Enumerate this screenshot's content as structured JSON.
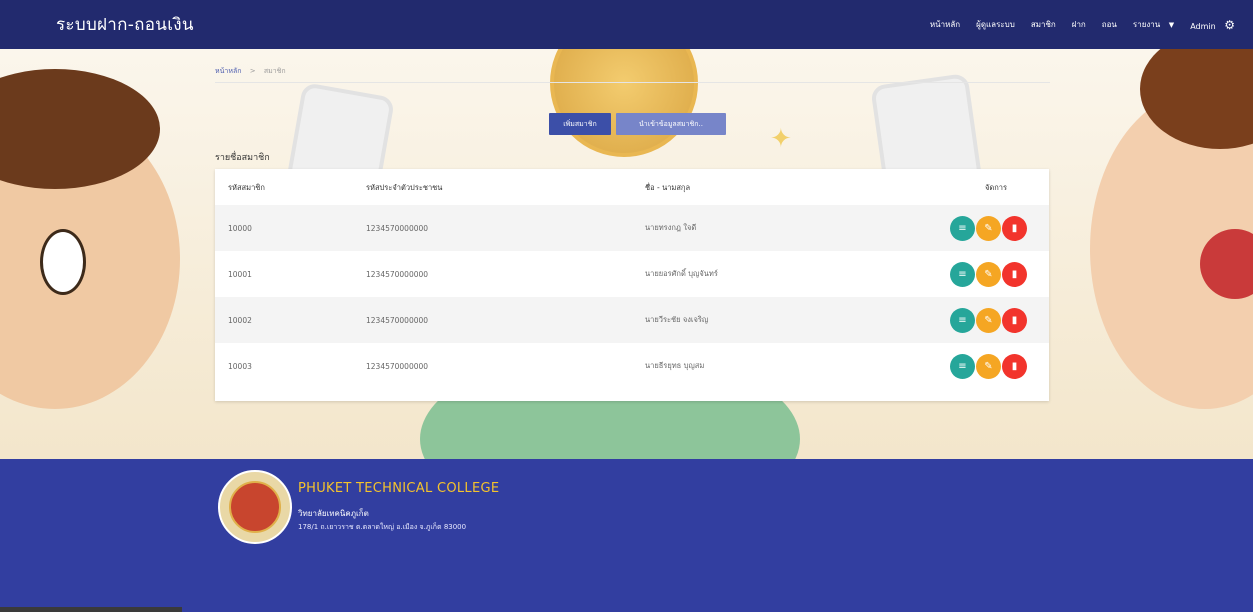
{
  "navbar": {
    "brand": "ระบบฝาก-ถอนเงิน",
    "links": [
      "หน้าหลัก",
      "ผู้ดูแลระบบ",
      "สมาชิก",
      "ฝาก",
      "ถอน",
      "รายงาน"
    ],
    "user": "Admin"
  },
  "breadcrumb": {
    "home": "หน้าหลัก",
    "separator": ">",
    "current": "สมาชิก"
  },
  "actions": {
    "add_member": "เพิ่มสมาชิก",
    "import_members": "นำเข้าข้อมูลสมาชิก.."
  },
  "list_title": "รายชื่อสมาชิก",
  "table": {
    "headers": [
      "รหัสสมาชิก",
      "รหัสประจำตัวประชาชน",
      "ชื่อ - นามสกุล",
      "จัดการ"
    ],
    "rows": [
      [
        "10000",
        "1234570000000",
        "นายทรงกฎ ใจดี"
      ],
      [
        "10001",
        "1234570000000",
        "นายยอรศักดิ์ บุญจันทร์"
      ],
      [
        "10002",
        "1234570000000",
        "นายวีระชัย จงเจริญ"
      ],
      [
        "10003",
        "1234570000000",
        "นายธีรยุทธ บุญสม"
      ]
    ]
  },
  "footer": {
    "college_en": "PHUKET TECHNICAL COLLEGE",
    "college_th": "วิทยาลัยเทคนิคภูเก็ต",
    "address": "178/1 ถ.เยาวราช ต.ตลาดใหญ่ อ.เมือง จ.ภูเก็ต 83000"
  },
  "colors": {
    "navbar": "#222a6e",
    "footer": "#323ea0",
    "primary_button": "#3c4fa8",
    "secondary_button": "#7785c9",
    "view": "#26a69a",
    "edit": "#f5a623",
    "delete": "#f2342c",
    "college_title": "#f5c32c"
  },
  "icons": {
    "settings": "gear-icon",
    "dropdown": "caret-down-icon",
    "view": "list-icon",
    "edit": "pencil-icon",
    "delete": "trash-icon"
  }
}
